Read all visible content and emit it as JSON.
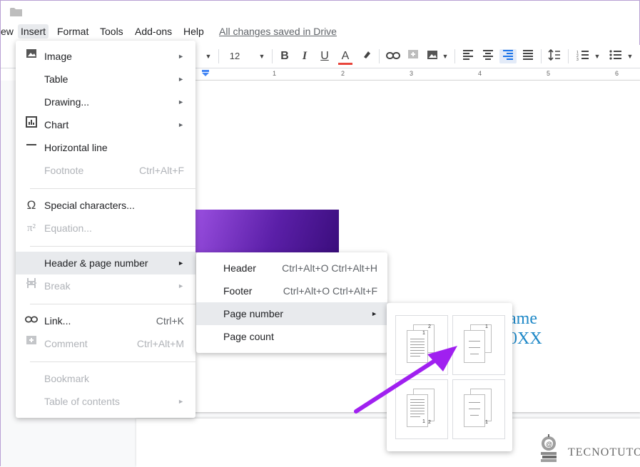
{
  "menubar": {
    "items": [
      "ew",
      "Insert",
      "Format",
      "Tools",
      "Add-ons",
      "Help"
    ],
    "saved_status": "All changes saved in Drive"
  },
  "toolbar": {
    "font_size": "12"
  },
  "ruler": {
    "ticks": [
      "1",
      "2",
      "3",
      "4",
      "5",
      "6"
    ]
  },
  "document": {
    "text_line1": "ame",
    "text_line2": "0XX"
  },
  "insert_menu": {
    "items": [
      {
        "label": "Image",
        "icon": "image-icon",
        "submenu": true
      },
      {
        "label": "Table",
        "submenu": true
      },
      {
        "label": "Drawing...",
        "submenu": true
      },
      {
        "label": "Chart",
        "icon": "chart-icon",
        "submenu": true
      },
      {
        "label": "Horizontal line",
        "icon": "horizontal-line-icon"
      },
      {
        "label": "Footnote",
        "shortcut": "Ctrl+Alt+F",
        "disabled": true
      },
      {
        "label": "Special characters...",
        "icon": "omega-icon"
      },
      {
        "label": "Equation...",
        "icon": "pi-icon",
        "disabled": true
      },
      {
        "label": "Header & page number",
        "submenu": true,
        "highlighted": true
      },
      {
        "label": "Break",
        "icon": "break-icon",
        "submenu": true,
        "disabled": true
      },
      {
        "label": "Link...",
        "icon": "link-icon",
        "shortcut": "Ctrl+K"
      },
      {
        "label": "Comment",
        "icon": "comment-icon",
        "shortcut": "Ctrl+Alt+M",
        "disabled": true
      },
      {
        "label": "Bookmark",
        "disabled": true
      },
      {
        "label": "Table of contents",
        "submenu": true,
        "disabled": true
      }
    ]
  },
  "header_submenu": {
    "items": [
      {
        "label": "Header",
        "shortcut": "Ctrl+Alt+O Ctrl+Alt+H"
      },
      {
        "label": "Footer",
        "shortcut": "Ctrl+Alt+O Ctrl+Alt+F"
      },
      {
        "label": "Page number",
        "submenu": true,
        "highlighted": true
      },
      {
        "label": "Page count"
      }
    ]
  },
  "page_number_options": {
    "top_left_numbers": [
      "1",
      "2"
    ],
    "top_right_number": "1",
    "bottom_left_numbers": [
      "1",
      "2"
    ],
    "bottom_right_number": "1"
  },
  "watermark": {
    "brand": "TECNOTUTO"
  },
  "colors": {
    "arrow": "#a020f0",
    "accent_blue": "#1e88c7",
    "text_color_bar": "#e8453c"
  }
}
